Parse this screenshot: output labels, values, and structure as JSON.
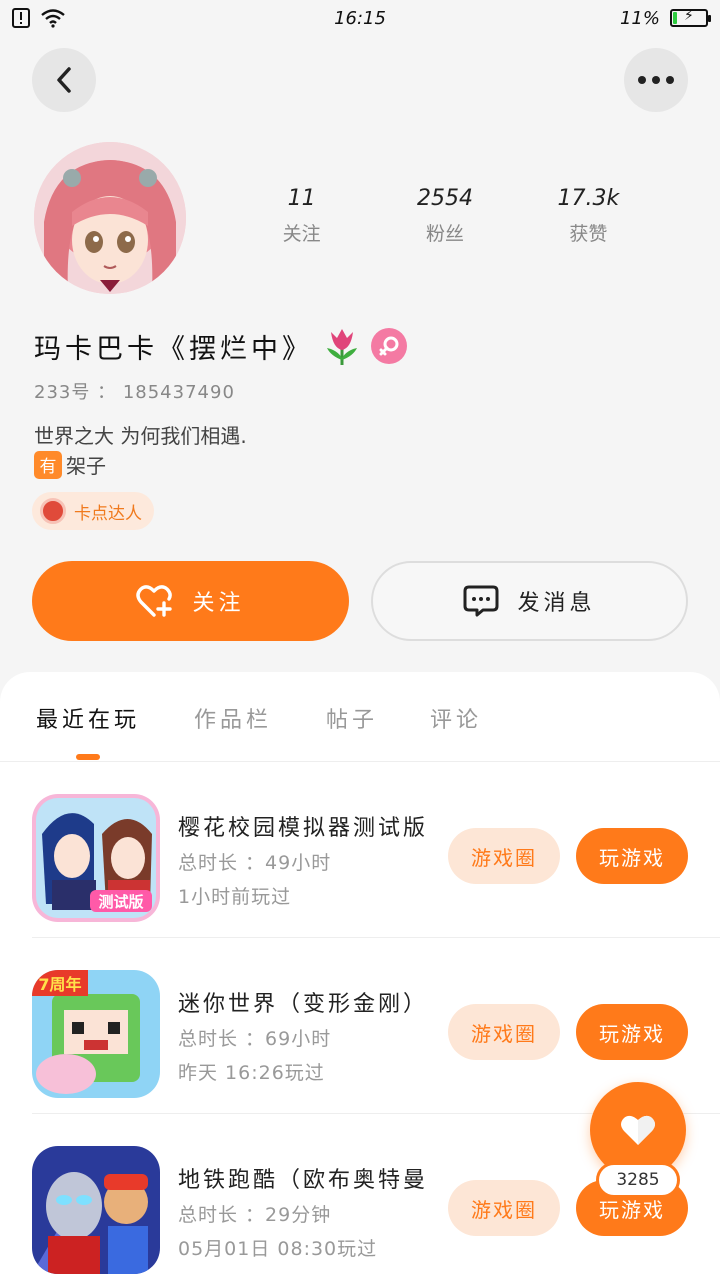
{
  "status_bar": {
    "time": "16:15",
    "battery": "11%",
    "battery_level": 0.11
  },
  "profile": {
    "stats": [
      {
        "value": "11",
        "label": "关注"
      },
      {
        "value": "2554",
        "label": "粉丝"
      },
      {
        "value": "17.3k",
        "label": "获赞"
      }
    ],
    "nickname": "玛卡巴卡《摆烂中》",
    "id_label": "233号",
    "id_value": "185437490",
    "bio_line1": "世界之大 为何我们相遇.",
    "bio_tag": "有",
    "bio_line2": "架子",
    "badge": "卡点达人"
  },
  "actions": {
    "follow": "关注",
    "message": "发消息"
  },
  "tabs": [
    {
      "label": "最近在玩",
      "active": true
    },
    {
      "label": "作品栏",
      "active": false
    },
    {
      "label": "帖子",
      "active": false
    },
    {
      "label": "评论",
      "active": false
    }
  ],
  "games": [
    {
      "title": "樱花校园模拟器测试版",
      "duration": "总时长 ：49小时",
      "last_played": "1小时前玩过",
      "circle": "游戏圈",
      "play": "玩游戏"
    },
    {
      "title": "迷你世界（变形金刚）",
      "duration": "总时长 ：69小时",
      "last_played": "昨天 16:26玩过",
      "circle": "游戏圈",
      "play": "玩游戏"
    },
    {
      "title": "地铁跑酷（欧布奥特曼）",
      "duration": "总时长 ：29分钟",
      "last_played": "05月01日 08:30玩过",
      "circle": "游戏圈",
      "play": "玩游戏"
    }
  ],
  "floating_like": {
    "count": "3285"
  },
  "colors": {
    "accent": "#ff7a1a",
    "accent_light": "#fde6d6",
    "pink": "#f47aa3"
  }
}
